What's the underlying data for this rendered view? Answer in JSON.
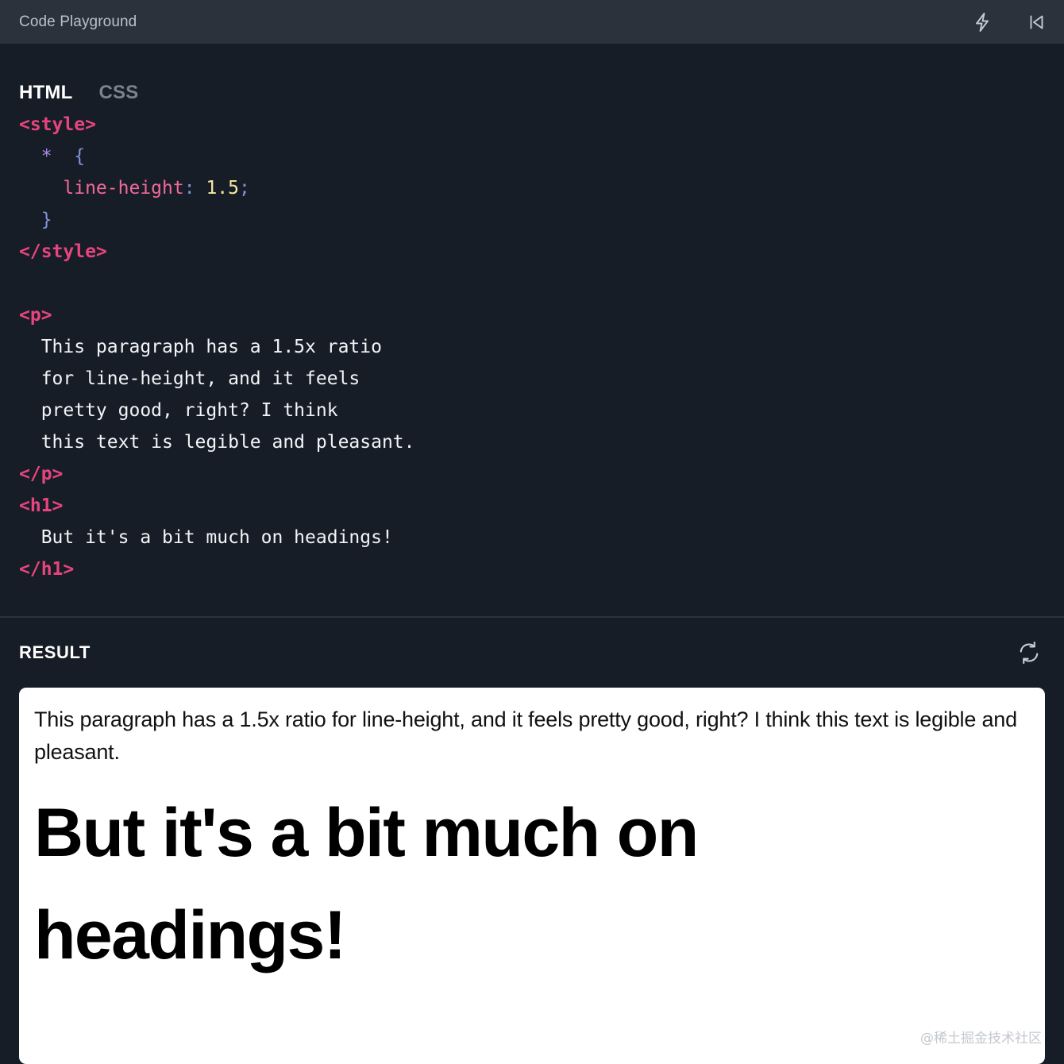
{
  "titlebar": {
    "title": "Code Playground",
    "actions": [
      {
        "name": "lightning-icon",
        "label": "Run"
      },
      {
        "name": "skip-back-icon",
        "label": "Previous"
      }
    ]
  },
  "editor": {
    "tabs": [
      {
        "label": "HTML",
        "active": true
      },
      {
        "label": "CSS",
        "active": false
      }
    ],
    "code_lines": [
      {
        "tokens": [
          {
            "type": "tag",
            "text": "<style>"
          }
        ]
      },
      {
        "tokens": [
          {
            "type": "txt",
            "text": "  "
          },
          {
            "type": "sel",
            "text": "*"
          },
          {
            "type": "txt",
            "text": "  "
          },
          {
            "type": "brace",
            "text": "{"
          }
        ]
      },
      {
        "tokens": [
          {
            "type": "txt",
            "text": "    "
          },
          {
            "type": "prop",
            "text": "line-height"
          },
          {
            "type": "punct",
            "text": ":"
          },
          {
            "type": "txt",
            "text": " "
          },
          {
            "type": "num",
            "text": "1.5"
          },
          {
            "type": "punct",
            "text": ";"
          }
        ]
      },
      {
        "tokens": [
          {
            "type": "txt",
            "text": "  "
          },
          {
            "type": "brace",
            "text": "}"
          }
        ]
      },
      {
        "tokens": [
          {
            "type": "tag",
            "text": "</style>"
          }
        ]
      },
      {
        "tokens": [
          {
            "type": "txt",
            "text": ""
          }
        ]
      },
      {
        "tokens": [
          {
            "type": "tag",
            "text": "<p>"
          }
        ]
      },
      {
        "tokens": [
          {
            "type": "txt",
            "text": "  This paragraph has a 1.5x ratio"
          }
        ]
      },
      {
        "tokens": [
          {
            "type": "txt",
            "text": "  for line-height, and it feels"
          }
        ]
      },
      {
        "tokens": [
          {
            "type": "txt",
            "text": "  pretty good, right? I think"
          }
        ]
      },
      {
        "tokens": [
          {
            "type": "txt",
            "text": "  this text is legible and pleasant."
          }
        ]
      },
      {
        "tokens": [
          {
            "type": "tag",
            "text": "</p>"
          }
        ]
      },
      {
        "tokens": [
          {
            "type": "tag",
            "text": "<h1>"
          }
        ]
      },
      {
        "tokens": [
          {
            "type": "txt",
            "text": "  But it's a bit much on headings!"
          }
        ]
      },
      {
        "tokens": [
          {
            "type": "tag",
            "text": "</h1>"
          }
        ]
      }
    ]
  },
  "result": {
    "title": "RESULT",
    "refresh_label": "Refresh",
    "paragraph": "This paragraph has a 1.5x ratio for line-height, and it feels pretty good, right? I think this text is legible and pleasant.",
    "heading": "But it's a bit much on headings!"
  },
  "watermark": "@稀土掘金技术社区",
  "colors": {
    "titlebar_bg": "#2c323c",
    "editor_bg": "#161d26",
    "card_bg": "#ffffff",
    "tag": "#e8447e",
    "selector": "#a98cf0",
    "brace": "#8293d8",
    "property": "#f06a9a",
    "number": "#f6e9a0",
    "code_text": "#f2f4f7",
    "tab_active": "#ffffff",
    "tab_inactive": "#79828f"
  }
}
